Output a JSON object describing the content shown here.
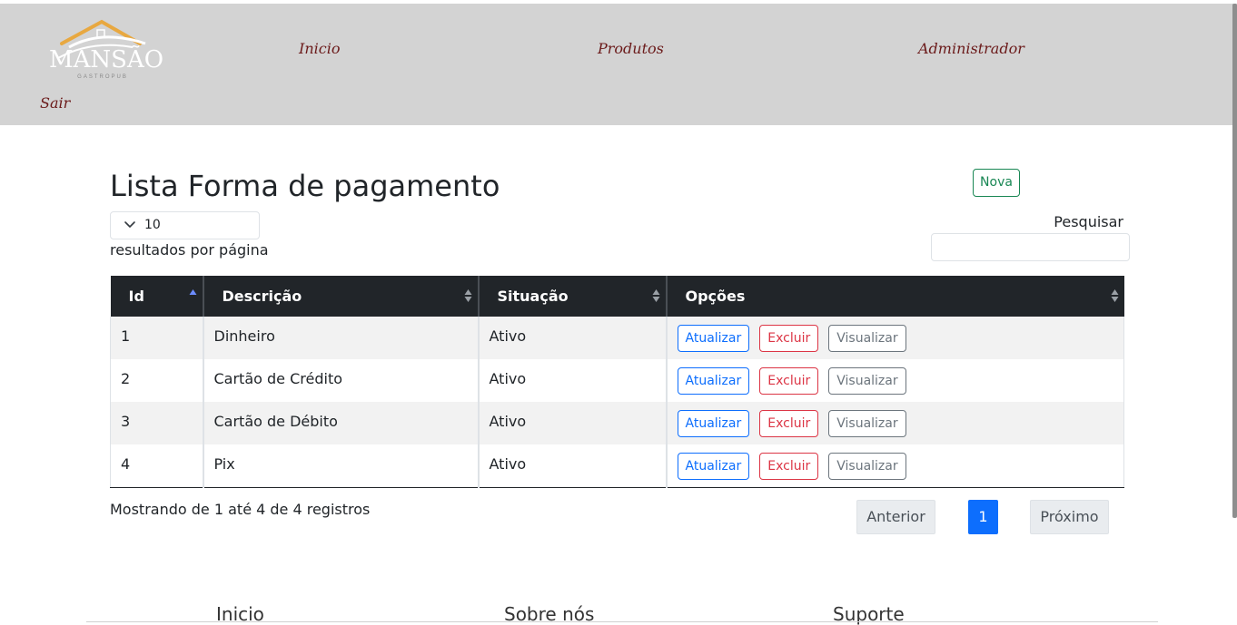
{
  "header": {
    "logo": {
      "name": "MANSÃO",
      "sub": "GASTROPUB"
    },
    "nav": {
      "inicio": "Inicio",
      "produtos": "Produtos",
      "administrador": "Administrador",
      "sair": "Sair"
    }
  },
  "page": {
    "title": "Lista Forma de pagamento",
    "new_button": "Nova",
    "length_value": "10",
    "length_label": "resultados por página",
    "search_label": "Pesquisar",
    "search_value": ""
  },
  "table": {
    "columns": [
      "Id",
      "Descrição",
      "Situação",
      "Opções"
    ],
    "rows": [
      {
        "id": "1",
        "descricao": "Dinheiro",
        "situacao": "Ativo"
      },
      {
        "id": "2",
        "descricao": "Cartão de Crédito",
        "situacao": "Ativo"
      },
      {
        "id": "3",
        "descricao": "Cartão de Débito",
        "situacao": "Ativo"
      },
      {
        "id": "4",
        "descricao": "Pix",
        "situacao": "Ativo"
      }
    ],
    "actions": {
      "update": "Atualizar",
      "delete": "Excluir",
      "view": "Visualizar"
    }
  },
  "pagination": {
    "info": "Mostrando de 1 até 4 de 4 registros",
    "previous": "Anterior",
    "current": "1",
    "next": "Próximo"
  },
  "footer": {
    "links": [
      "Inicio",
      "Sobre nós",
      "Suporte"
    ]
  },
  "colors": {
    "header_bg": "#d3d3d3",
    "table_header": "#212529",
    "primary": "#0d6efd",
    "danger": "#dc3545",
    "success": "#198754",
    "secondary": "#6c757d",
    "nav_text": "#6b1a1a"
  }
}
